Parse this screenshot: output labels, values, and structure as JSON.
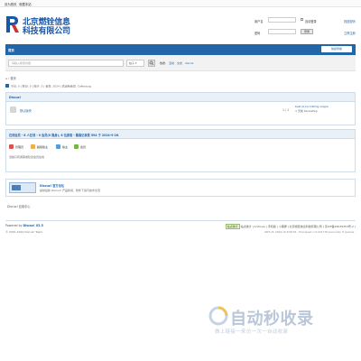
{
  "topbar": {
    "set_home": "设为首页",
    "favorite": "收藏本站"
  },
  "logo": {
    "line1": "北京燃铨信息",
    "line2": "科技有限公司"
  },
  "login": {
    "user_label": "用户名",
    "pass_label": "密码",
    "auto_login": "自动登录",
    "find_password": "找回密码",
    "login_button": "登录",
    "register": "立即注册"
  },
  "nav": {
    "home": "首页",
    "quick": "快捷导航"
  },
  "search": {
    "placeholder": "请输入搜索内容",
    "type": "帖子",
    "hot_label": "热搜:",
    "hot": [
      "活动",
      "交友",
      "discuz"
    ]
  },
  "breadcrumb": "首页",
  "stats": "今日: 0 | 昨日: 0 | 帖子: 3 | 会员: 2024 | 欢迎新会员: CaNsousg",
  "forum_section": {
    "title": "Discuz!",
    "forum_name": "默认版块",
    "count": "1 / 1",
    "last_title": "best price 100mg viagra",
    "last_meta": "3 天前 KanoePep"
  },
  "online": {
    "title": "在线会员 - 6 人在线 - 0 会员(0 隐身), 6 位游客 - 最高记录是 594 于 2024-9-26.",
    "legend": [
      "管理员",
      "超级版主",
      "版主",
      "会员"
    ],
    "legend_colors": [
      "#d9534f",
      "#f0ad4e",
      "#5b9bd5",
      "#7cb342"
    ],
    "note": "当前只有游客或隐身会员在线"
  },
  "partner": {
    "title": "Discuz! 官方论坛",
    "desc": "提供最新 Discuz! 产品新闻、软件下载与技术交流"
  },
  "app_center": "Discuz! 应用中心",
  "footer": {
    "powered": "Powered by",
    "powered_brand": "Discuz! X3.5",
    "copyright": "© 2001-2024 Discuz! Team.",
    "links": "站点统计 | Archiver | 手机版 | 小黑屋 | 北京燃铨信息科技有限公司 ( 京ICP备19039353号-2 )",
    "badge": "站点统计",
    "gmt": "GMT+8, 2024-10-8 08:54 , Processed in 0.021776 second(s), 8 queries ."
  },
  "watermark": {
    "big": "自动秒收录",
    "small": "做上链接一来访一次一自动收录"
  }
}
